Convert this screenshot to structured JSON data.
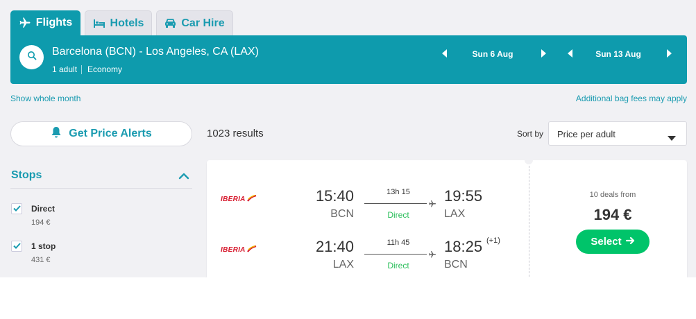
{
  "tabs": [
    {
      "label": "Flights",
      "icon": "plane-icon",
      "active": true
    },
    {
      "label": "Hotels",
      "icon": "bed-icon",
      "active": false
    },
    {
      "label": "Car Hire",
      "icon": "car-icon",
      "active": false
    }
  ],
  "search": {
    "route": "Barcelona (BCN) - Los Angeles, CA (LAX)",
    "passengers": "1 adult",
    "cabin": "Economy",
    "depart_date": "Sun 6 Aug",
    "return_date": "Sun 13 Aug"
  },
  "links": {
    "whole_month": "Show whole month",
    "bag_fees": "Additional bag fees may apply"
  },
  "sidebar": {
    "alerts_label": "Get Price Alerts",
    "stops_title": "Stops",
    "filters": [
      {
        "label": "Direct",
        "price": "194 €",
        "checked": true
      },
      {
        "label": "1 stop",
        "price": "431 €",
        "checked": true
      }
    ]
  },
  "results": {
    "count": "1023 results",
    "sort_label": "Sort by",
    "sort_value": "Price per adult"
  },
  "card": {
    "airline": "IBERIA",
    "legs": [
      {
        "dep_time": "15:40",
        "dep_code": "BCN",
        "duration": "13h 15",
        "stops": "Direct",
        "arr_time": "19:55",
        "arr_code": "LAX",
        "day_offset": ""
      },
      {
        "dep_time": "21:40",
        "dep_code": "LAX",
        "duration": "11h 45",
        "stops": "Direct",
        "arr_time": "18:25",
        "arr_code": "BCN",
        "day_offset": "(+1)"
      }
    ],
    "deals": "10 deals from",
    "price": "194 €",
    "select_label": "Select"
  },
  "colors": {
    "brand": "#0e9bad",
    "link": "#1a9bb0",
    "select": "#00c46a",
    "direct": "#2bbf5b",
    "airline": "#d7192d"
  }
}
